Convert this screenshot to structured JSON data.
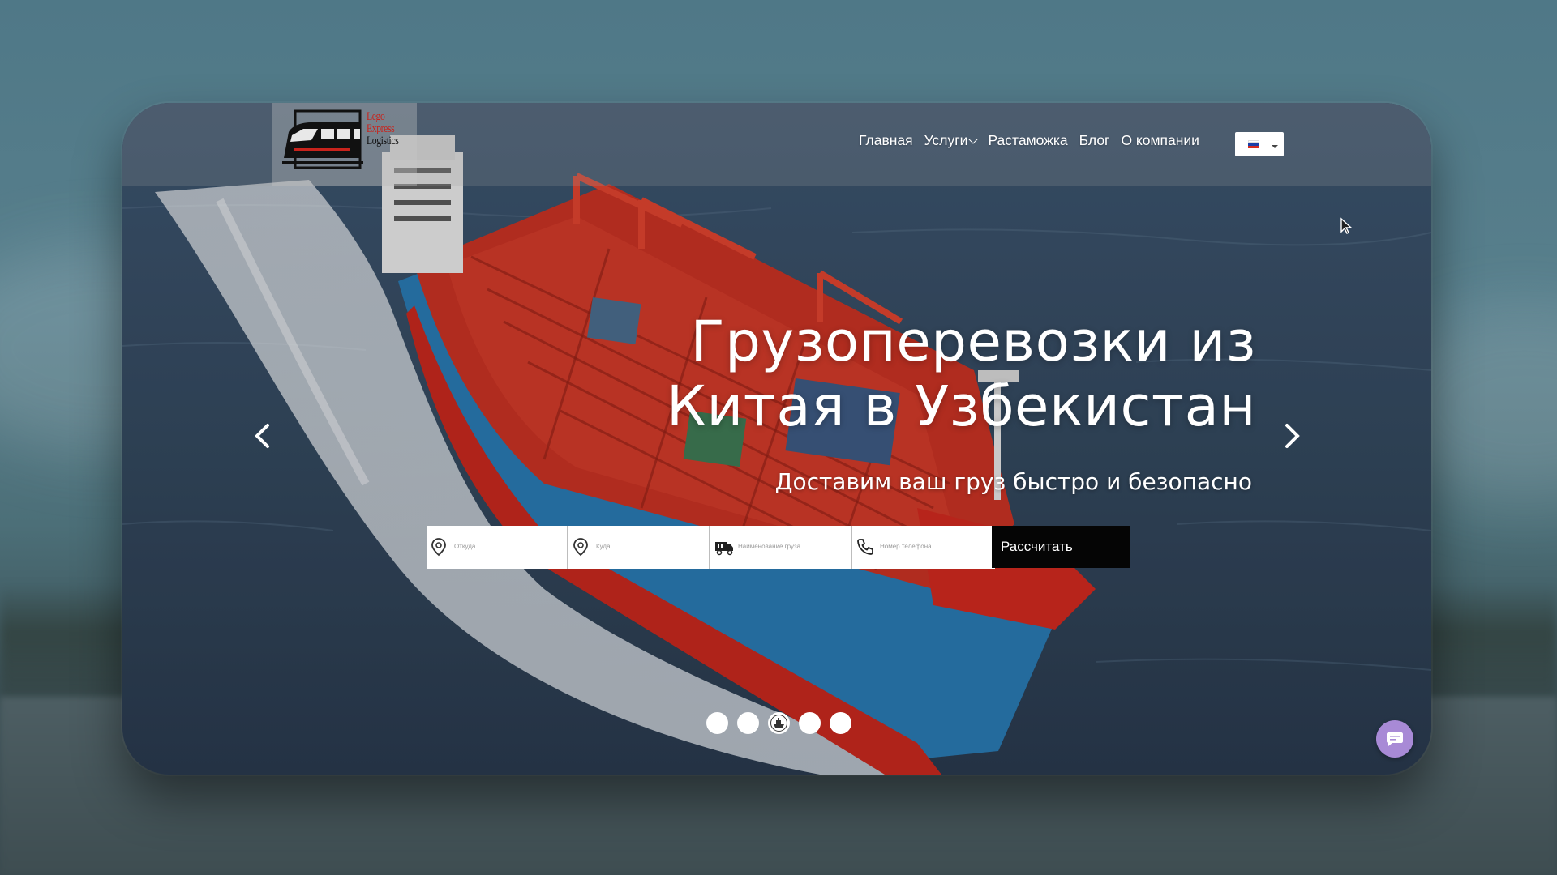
{
  "brand": {
    "logo_lines": [
      "Lego",
      "Express",
      "Logistics"
    ]
  },
  "nav": {
    "items": [
      {
        "label": "Главная"
      },
      {
        "label": "Услуги"
      },
      {
        "label": "Растаможка"
      },
      {
        "label": "Блог"
      },
      {
        "label": "О компании"
      }
    ],
    "language": "ru"
  },
  "hero": {
    "title_line1": "Грузоперевозки из",
    "title_line2": "Китая в Узбекистан",
    "subtitle": "Доставим ваш груз быстро и безопасно"
  },
  "form": {
    "from_placeholder": "Откуда",
    "to_placeholder": "Куда",
    "cargo_placeholder": "Наименование груза",
    "phone_placeholder": "Номер телефона",
    "submit_label": "Рассчитать"
  },
  "slider": {
    "slide_count": 5,
    "active_index": 3
  },
  "colors": {
    "logo_red": "#c8231c",
    "chat_button": "#a88ad6",
    "submit_bg": "#050505"
  }
}
